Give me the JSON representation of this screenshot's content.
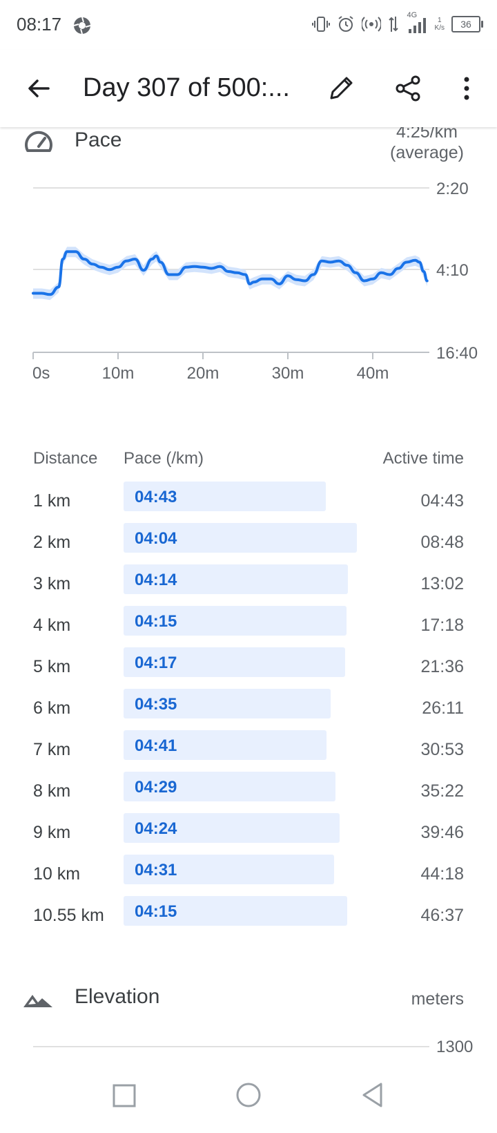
{
  "status_bar": {
    "time": "08:17",
    "network": "4G",
    "speed_value": "1",
    "speed_unit": "K/s",
    "battery": "36"
  },
  "app_bar": {
    "title": "Day 307 of 500:..."
  },
  "pace": {
    "label": "Pace",
    "average_value": "4:25/km",
    "average_note": "(average)"
  },
  "chart_data": {
    "type": "line",
    "title": "",
    "x_tick_labels": [
      "0s",
      "10m",
      "20m",
      "30m",
      "40m"
    ],
    "x_ticks_minutes": [
      0,
      10,
      20,
      30,
      40
    ],
    "y_tick_labels": [
      "2:20",
      "4:10",
      "16:40"
    ],
    "y_axis_inverted": true,
    "grid": true,
    "line_color": "#1a73e8",
    "band_color": "#d2e3fc",
    "series": [
      {
        "x_minutes": [
          0,
          1,
          2,
          3,
          3.5,
          4,
          5,
          6,
          7,
          8,
          9,
          10,
          11,
          12,
          13,
          14,
          14.5,
          15,
          16,
          17,
          18,
          19,
          20,
          21,
          22,
          23,
          24,
          25,
          25.5,
          26,
          27,
          28,
          29,
          30,
          31,
          32,
          33,
          34,
          35,
          36,
          37,
          38,
          39,
          40,
          41,
          42,
          43,
          44,
          45,
          45.5,
          46,
          46.4
        ],
        "pace_minutes_per_km": [
          4.55,
          4.55,
          4.57,
          4.45,
          4.0,
          3.88,
          3.88,
          4.0,
          4.08,
          4.13,
          4.17,
          4.13,
          4.03,
          4.0,
          4.18,
          4.0,
          3.95,
          4.05,
          4.25,
          4.25,
          4.13,
          4.12,
          4.13,
          4.15,
          4.12,
          4.2,
          4.22,
          4.25,
          4.4,
          4.37,
          4.32,
          4.32,
          4.4,
          4.27,
          4.33,
          4.35,
          4.25,
          4.03,
          4.05,
          4.03,
          4.1,
          4.22,
          4.35,
          4.32,
          4.22,
          4.25,
          4.15,
          4.05,
          4.02,
          4.05,
          4.2,
          4.35
        ]
      }
    ]
  },
  "splits": {
    "headers": {
      "distance": "Distance",
      "pace": "Pace (/km)",
      "active_time": "Active time"
    },
    "rows": [
      {
        "distance": "1 km",
        "pace": "04:43",
        "active_time": "04:43",
        "bar_fraction": 0.866
      },
      {
        "distance": "2 km",
        "pace": "04:04",
        "active_time": "08:48",
        "bar_fraction": 1.0
      },
      {
        "distance": "3 km",
        "pace": "04:14",
        "active_time": "13:02",
        "bar_fraction": 0.961
      },
      {
        "distance": "4 km",
        "pace": "04:15",
        "active_time": "17:18",
        "bar_fraction": 0.957
      },
      {
        "distance": "5 km",
        "pace": "04:17",
        "active_time": "21:36",
        "bar_fraction": 0.951
      },
      {
        "distance": "6 km",
        "pace": "04:35",
        "active_time": "26:11",
        "bar_fraction": 0.888
      },
      {
        "distance": "7 km",
        "pace": "04:41",
        "active_time": "30:53",
        "bar_fraction": 0.869
      },
      {
        "distance": "8 km",
        "pace": "04:29",
        "active_time": "35:22",
        "bar_fraction": 0.908
      },
      {
        "distance": "9 km",
        "pace": "04:24",
        "active_time": "39:46",
        "bar_fraction": 0.925
      },
      {
        "distance": "10 km",
        "pace": "04:31",
        "active_time": "44:18",
        "bar_fraction": 0.901
      },
      {
        "distance": "10.55 km",
        "pace": "04:15",
        "active_time": "46:37",
        "bar_fraction": 0.958
      }
    ]
  },
  "elevation": {
    "label": "Elevation",
    "unit": "meters",
    "top_tick": "1300"
  },
  "icons": {
    "back": "arrow-back-icon",
    "edit": "pencil-icon",
    "share": "share-icon",
    "more": "more-vert-icon",
    "pace": "speedometer-icon",
    "elevation": "mountain-icon",
    "nav_recents": "square-icon",
    "nav_home": "circle-icon",
    "nav_back": "triangle-back-icon"
  }
}
